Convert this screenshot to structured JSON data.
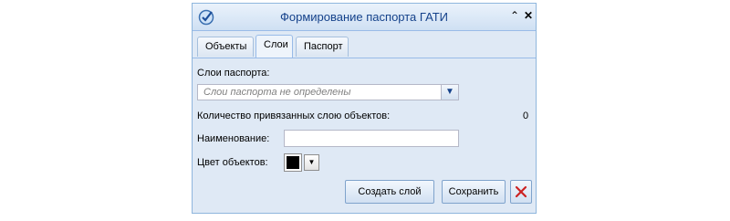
{
  "window": {
    "title": "Формирование паспорта ГАТИ",
    "icons": {
      "app": "check-badge-icon",
      "collapse": "collapse-icon",
      "close": "close-icon"
    }
  },
  "tabs": [
    {
      "label": "Объекты",
      "active": false
    },
    {
      "label": "Слои",
      "active": true
    },
    {
      "label": "Паспорт",
      "active": false
    }
  ],
  "form": {
    "layers_label": "Слои паспорта:",
    "layers_value": "Слои паспорта не определены",
    "linked_count_label": "Количество привязанных слою объектов:",
    "linked_count_value": "0",
    "name_label": "Наименование:",
    "name_value": "",
    "color_label": "Цвет объектов:",
    "color_value": "#000000"
  },
  "buttons": {
    "create": "Создать слой",
    "save": "Сохранить",
    "delete_icon": "delete-icon"
  },
  "colors": {
    "title_text": "#15428b",
    "panel_bg": "#dfe9f5",
    "delete": "#cc2222"
  }
}
